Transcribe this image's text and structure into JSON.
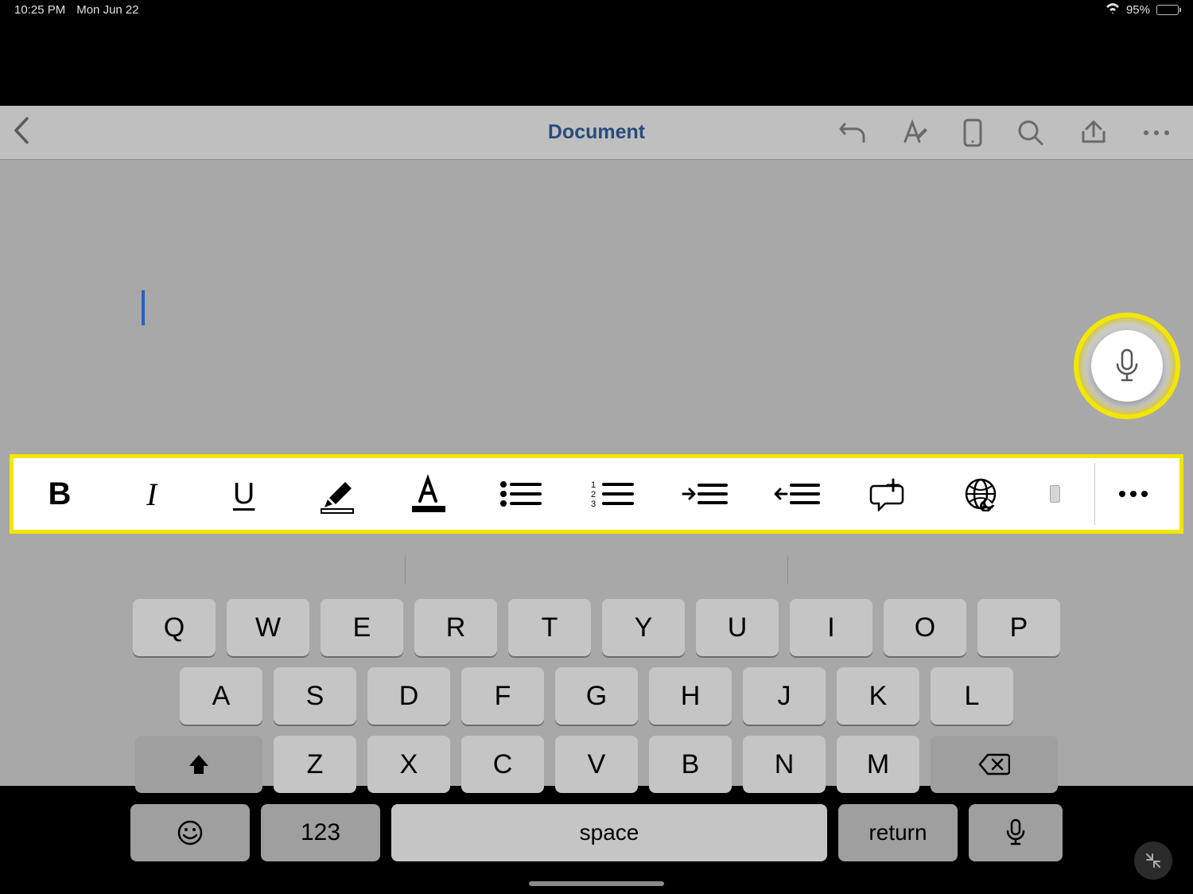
{
  "status": {
    "time": "10:25 PM",
    "date": "Mon Jun 22",
    "battery_pct": "95%",
    "battery_fill_pct": 95
  },
  "nav": {
    "title": "Document"
  },
  "format_toolbar": {
    "bold": "B",
    "italic": "I",
    "underline": "U"
  },
  "keyboard": {
    "row1": [
      "Q",
      "W",
      "E",
      "R",
      "T",
      "Y",
      "U",
      "I",
      "O",
      "P"
    ],
    "row2": [
      "A",
      "S",
      "D",
      "F",
      "G",
      "H",
      "J",
      "K",
      "L"
    ],
    "row3": [
      "Z",
      "X",
      "C",
      "V",
      "B",
      "N",
      "M"
    ],
    "numbers_label": "123",
    "space_label": "space",
    "return_label": "return"
  }
}
